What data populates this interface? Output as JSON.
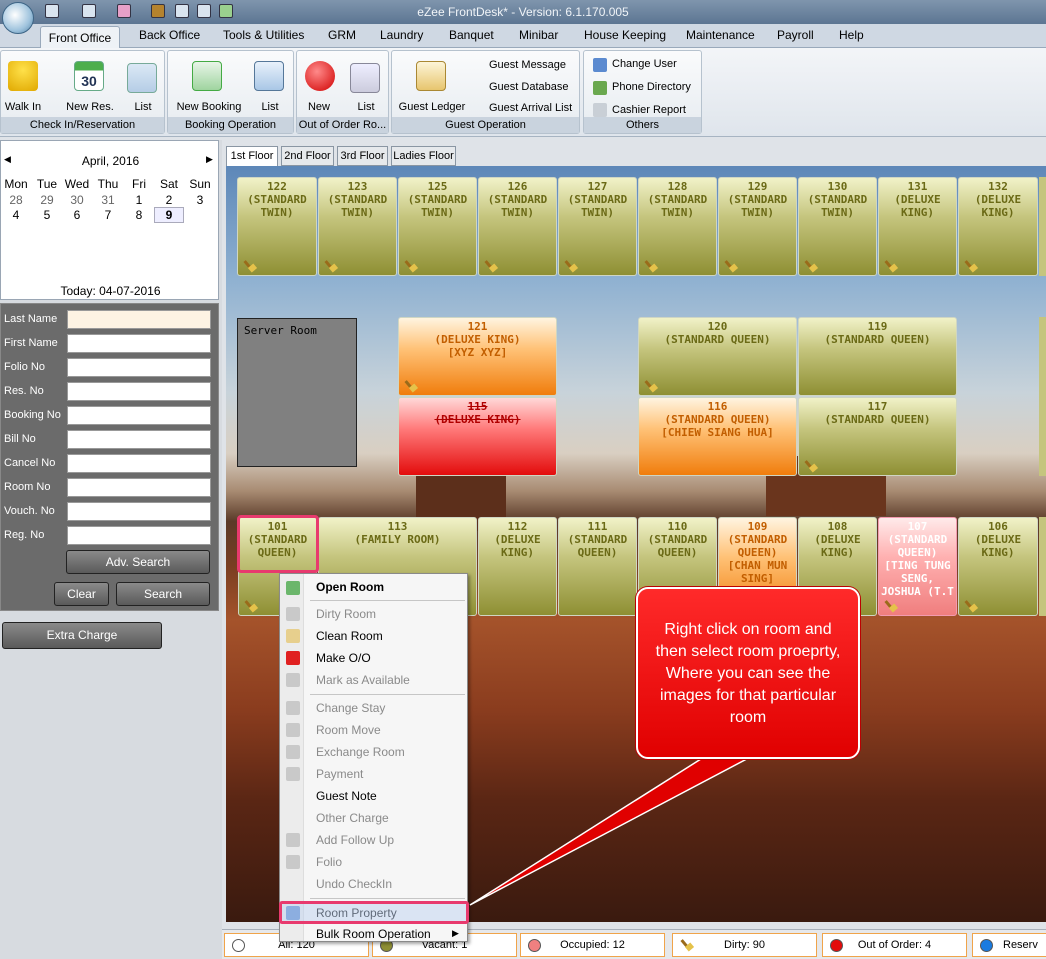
{
  "window": {
    "title": "eZee FrontDesk* - Version: 6.1.170.005"
  },
  "menu_tabs": [
    "Front Office",
    "Back Office",
    "Tools & Utilities",
    "GRM",
    "Laundry",
    "Banquet",
    "Minibar",
    "House Keeping",
    "Maintenance",
    "Payroll",
    "Help"
  ],
  "ribbon": {
    "checkin": {
      "label": "Check In/Reservation",
      "walkin": "Walk In",
      "new_res": "New Res.",
      "list": "List",
      "calendar_num": "30"
    },
    "booking": {
      "label": "Booking Operation",
      "new_booking": "New Booking",
      "list": "List"
    },
    "ooo": {
      "label": "Out of Order Ro...",
      "new": "New",
      "list": "List"
    },
    "guest": {
      "label": "Guest Operation",
      "ledger": "Guest Ledger",
      "message": "Guest Message",
      "database": "Guest Database",
      "arrival": "Guest Arrival List"
    },
    "others": {
      "label": "Others",
      "change_user": "Change User",
      "phone": "Phone Directory",
      "cashier": "Cashier Report"
    }
  },
  "calendar": {
    "month": "April, 2016",
    "day_names": [
      "Mon",
      "Tue",
      "Wed",
      "Thu",
      "Fri",
      "Sat",
      "Sun"
    ],
    "row1": [
      "28",
      "29",
      "30",
      "31",
      "1",
      "2",
      "3"
    ],
    "row2": [
      "4",
      "5",
      "6",
      "7",
      "8",
      "9"
    ],
    "today": "Today: 04-07-2016"
  },
  "search": {
    "fields": [
      "Last Name",
      "First Name",
      "Folio No",
      "Res. No",
      "Booking No",
      "Bill No",
      "Cancel No",
      "Room No",
      "Vouch. No",
      "Reg. No"
    ],
    "adv_search": "Adv. Search",
    "clear": "Clear",
    "search": "Search",
    "extra_charge": "Extra Charge"
  },
  "floors": [
    "1st Floor",
    "2nd Floor",
    "3rd Floor",
    "Ladies Floor"
  ],
  "rooms": {
    "r122": {
      "num": "122",
      "type": "(STANDARD TWIN)"
    },
    "r123": {
      "num": "123",
      "type": "(STANDARD TWIN)"
    },
    "r125": {
      "num": "125",
      "type": "(STANDARD TWIN)"
    },
    "r126": {
      "num": "126",
      "type": "(STANDARD TWIN)"
    },
    "r127": {
      "num": "127",
      "type": "(STANDARD TWIN)"
    },
    "r128": {
      "num": "128",
      "type": "(STANDARD TWIN)"
    },
    "r129": {
      "num": "129",
      "type": "(STANDARD TWIN)"
    },
    "r130": {
      "num": "130",
      "type": "(STANDARD TWIN)"
    },
    "r131": {
      "num": "131",
      "type": "(DELUXE KING)"
    },
    "r132": {
      "num": "132",
      "type": "(DELUXE KING)"
    },
    "r121": {
      "num": "121",
      "type": "(DELUXE KING)",
      "guest": "[XYZ XYZ]"
    },
    "r120": {
      "num": "120",
      "type": "(STANDARD QUEEN)"
    },
    "r119": {
      "num": "119",
      "type": "(STANDARD QUEEN)"
    },
    "r115": {
      "num": "115",
      "type": "(DELUXE KING)"
    },
    "r116": {
      "num": "116",
      "type": "(STANDARD QUEEN)",
      "guest": "[CHIEW SIANG HUA]"
    },
    "r117": {
      "num": "117",
      "type": "(STANDARD QUEEN)"
    },
    "r101": {
      "num": "101",
      "type": "(STANDARD QUEEN)"
    },
    "r113": {
      "num": "113",
      "type": "(FAMILY ROOM)"
    },
    "r112": {
      "num": "112",
      "type": "(DELUXE KING)"
    },
    "r111": {
      "num": "111",
      "type": "(STANDARD QUEEN)"
    },
    "r110": {
      "num": "110",
      "type": "(STANDARD QUEEN)"
    },
    "r109": {
      "num": "109",
      "type": "(STANDARD QUEEN)",
      "guest": "[CHAN MUN SING]"
    },
    "r108": {
      "num": "108",
      "type": "(DELUXE KING)"
    },
    "r107": {
      "num": "107",
      "type": "(STANDARD QUEEN)",
      "guest": "[TING TUNG SENG, JOSHUA (T.T"
    },
    "r106": {
      "num": "106",
      "type": "(DELUXE KING)"
    }
  },
  "server_room": "Server Room",
  "context_menu": [
    "Open Room",
    "Dirty Room",
    "Clean Room",
    "Make O/O",
    "Mark as Available",
    "Change Stay",
    "Room Move",
    "Exchange Room",
    "Payment",
    "Guest Note",
    "Other Charge",
    "Add Follow Up",
    "Folio",
    "Undo CheckIn",
    "Room Property",
    "Bulk Room Operation"
  ],
  "callout": "Right click on room and then select room proeprty, Where you can see the images for that particular room",
  "status": {
    "all": "All: 120",
    "vacant": "Vacant: 1",
    "occupied": "Occupied: 12",
    "dirty": "Dirty: 90",
    "ooo": "Out of Order: 4",
    "reserved": "Reserv"
  },
  "colors": {
    "accent": "#e83a6e",
    "callout": "#ff1a1a",
    "occupied": "#f07d0c",
    "out_of_order": "#e30c0c",
    "clean": "#8e8f33"
  }
}
